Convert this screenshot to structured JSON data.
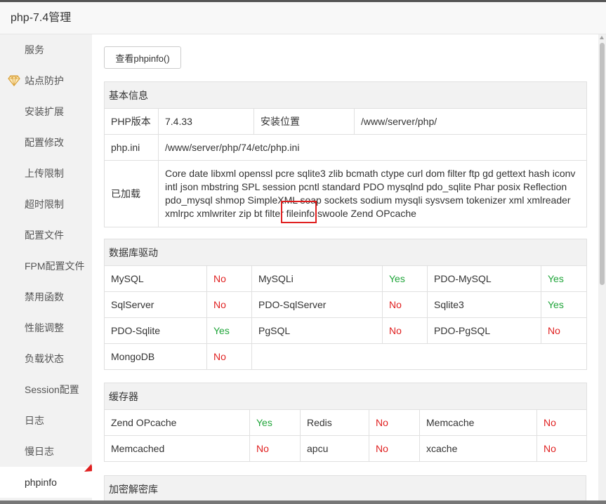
{
  "window": {
    "title": "php-7.4管理"
  },
  "sidebar": {
    "items": [
      {
        "label": "服务"
      },
      {
        "label": "站点防护",
        "icon": "gem-icon"
      },
      {
        "label": "安装扩展"
      },
      {
        "label": "配置修改"
      },
      {
        "label": "上传限制"
      },
      {
        "label": "超时限制"
      },
      {
        "label": "配置文件"
      },
      {
        "label": "FPM配置文件"
      },
      {
        "label": "禁用函数"
      },
      {
        "label": "性能调整"
      },
      {
        "label": "负载状态"
      },
      {
        "label": "Session配置"
      },
      {
        "label": "日志"
      },
      {
        "label": "慢日志"
      },
      {
        "label": "phpinfo",
        "active": true
      }
    ]
  },
  "toolbar": {
    "phpinfo_button": "查看phpinfo()"
  },
  "basic": {
    "title": "基本信息",
    "php_version_label": "PHP版本",
    "php_version": "7.4.33",
    "install_label": "安装位置",
    "install_path": "/www/server/php/",
    "ini_label": "php.ini",
    "ini_path": "/www/server/php/74/etc/php.ini",
    "loaded_label": "已加载",
    "loaded_modules": "Core date libxml openssl pcre sqlite3 zlib bcmath ctype curl dom filter ftp gd gettext hash iconv intl json mbstring SPL session pcntl standard PDO mysqlnd pdo_sqlite Phar posix Reflection pdo_mysql shmop SimpleXML soap sockets sodium mysqli sysvsem tokenizer xml xmlreader xmlrpc xmlwriter zip bt filter fileinfo swoole Zend OPcache"
  },
  "database": {
    "title": "数据库驱动",
    "rows": [
      [
        {
          "name": "MySQL",
          "status": "No"
        },
        {
          "name": "MySQLi",
          "status": "Yes"
        },
        {
          "name": "PDO-MySQL",
          "status": "Yes"
        }
      ],
      [
        {
          "name": "SqlServer",
          "status": "No"
        },
        {
          "name": "PDO-SqlServer",
          "status": "No"
        },
        {
          "name": "Sqlite3",
          "status": "Yes"
        }
      ],
      [
        {
          "name": "PDO-Sqlite",
          "status": "Yes"
        },
        {
          "name": "PgSQL",
          "status": "No"
        },
        {
          "name": "PDO-PgSQL",
          "status": "No"
        }
      ],
      [
        {
          "name": "MongoDB",
          "status": "No"
        }
      ]
    ]
  },
  "cache": {
    "title": "缓存器",
    "rows": [
      [
        {
          "name": "Zend OPcache",
          "status": "Yes"
        },
        {
          "name": "Redis",
          "status": "No"
        },
        {
          "name": "Memcache",
          "status": "No"
        }
      ],
      [
        {
          "name": "Memcached",
          "status": "No"
        },
        {
          "name": "apcu",
          "status": "No"
        },
        {
          "name": "xcache",
          "status": "No"
        }
      ]
    ]
  },
  "crypto": {
    "title": "加密解密库"
  },
  "colors": {
    "yes": "#20a53a",
    "no": "#e02020",
    "annotation": "#e02020"
  }
}
